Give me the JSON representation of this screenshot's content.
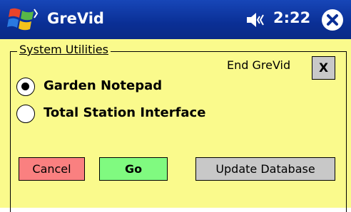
{
  "titlebar": {
    "app_title": "GreVid",
    "clock": "2:22",
    "icons": {
      "start": "windows-start-icon",
      "volume": "speaker-icon",
      "close": "close-circle-icon"
    }
  },
  "group": {
    "label": "System Utilities",
    "end_label": "End GreVid",
    "x_button": "X"
  },
  "options": [
    {
      "label": "Garden Notepad",
      "selected": true
    },
    {
      "label": "Total Station Interface",
      "selected": false
    }
  ],
  "buttons": {
    "cancel": "Cancel",
    "go": "Go",
    "update": "Update Database"
  },
  "colors": {
    "titlebar": "#0a2f95",
    "panel": "#fafa8c",
    "cancel": "#fa8080",
    "go": "#80fa80",
    "neutral_button": "#c8c8c8"
  }
}
